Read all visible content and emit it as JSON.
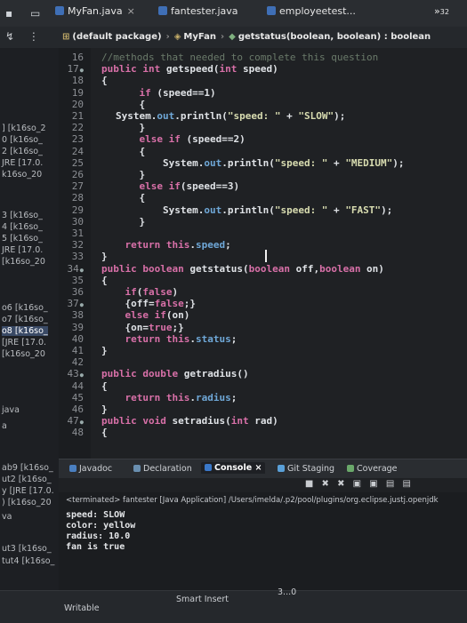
{
  "tabs": [
    {
      "label": "MyFan.java",
      "close": "×"
    },
    {
      "label": "fantester.java"
    },
    {
      "label": "employeetest..."
    }
  ],
  "tab_overflow": "»",
  "tab_overflow_count": "32",
  "breadcrumb": {
    "package": "(default package)",
    "class": "MyFan",
    "method": "getstatus(boolean, boolean) : boolean"
  },
  "left_panel": {
    "items": [
      "] [k16so_2",
      "0 [k16so_",
      "2 [k16so_",
      "JRE [17.0.",
      "k16so_20",
      "3 [k16so_",
      "4 [k16so_",
      "5 [k16so_",
      "JRE [17.0.",
      "[k16so_20",
      "o6 [k16so_",
      "o7 [k16so_",
      "o8 [k16so_",
      "[JRE [17.0.",
      "[k16so_20",
      "java",
      "a",
      "ab9 [k16so_",
      "ut2 [k16so_",
      "y [JRE [17.0.",
      ") [k16so_20",
      "va",
      "ut3 [k16so_",
      "tut4 [k16so_"
    ]
  },
  "line_numbers": [
    "16",
    "17",
    "18",
    "19",
    "20",
    "21",
    "22",
    "23",
    "24",
    "25",
    "26",
    "27",
    "28",
    "29",
    "30",
    "31",
    "32",
    "33",
    "34",
    "35",
    "36",
    "37",
    "38",
    "39",
    "40",
    "41",
    "42",
    "43",
    "44",
    "45",
    "46",
    "47",
    "48"
  ],
  "code_lines": [
    "//methods that needed to complete this question",
    "public int getspeed(int speed)",
    "{",
    "    if (speed==1)",
    "    {",
    "System.out.println(\"speed: \" + \"SLOW\");",
    "    }",
    "    else if (speed==2)",
    "    {",
    "        System.out.println(\"speed: \" + \"MEDIUM\");",
    "    }",
    "    else if(speed==3)",
    "    {",
    "        System.out.println(\"speed: \" + \"FAST\");",
    "    }",
    "",
    "    return this.speed;",
    "}",
    "public boolean getstatus(boolean off,boolean on)",
    "{",
    "    if(false)",
    "    {off=false;}",
    "    else if(on)",
    "    {on=true;}",
    "    return this.status;",
    "}",
    "",
    "public double getradius()",
    "{",
    "    return this.radius;",
    "}",
    "public void setradius(int rad)",
    "{"
  ],
  "panel": {
    "tabs": [
      "Javadoc",
      "Declaration",
      "Console",
      "Git Staging",
      "Coverage"
    ],
    "console_close": "×",
    "terminated": "<terminated> fantester [Java Application] /Users/imelda/.p2/pool/plugins/org.eclipse.justj.openjdk",
    "output": [
      "speed: SLOW",
      "color: yellow",
      "radius: 10.0",
      "fan is true"
    ]
  },
  "status_bar": {
    "writable": "Writable",
    "insert_mode": "Smart Insert",
    "position": "3...0"
  }
}
